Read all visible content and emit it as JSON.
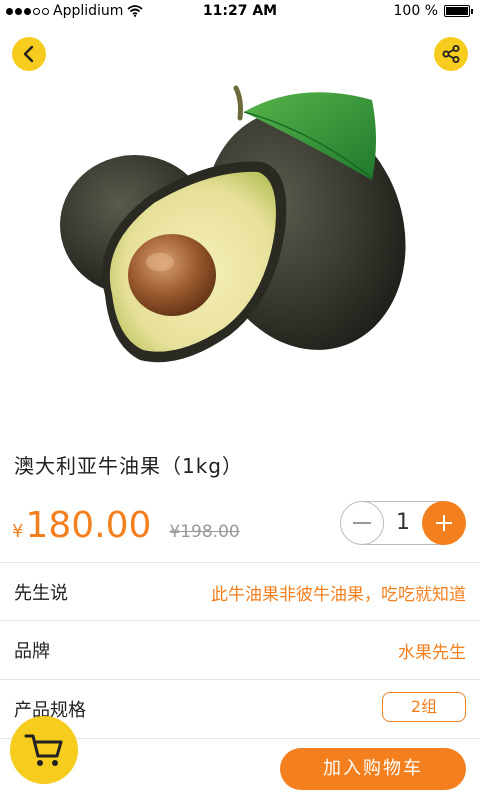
{
  "status_bar": {
    "carrier": "Applidium",
    "time": "11:27 AM",
    "battery": "100 %"
  },
  "product": {
    "title": "澳大利亚牛油果（1kg）",
    "currency": "¥",
    "price": "180.00",
    "old_price": "¥198.00"
  },
  "quantity": {
    "value": "1"
  },
  "info": {
    "slogan_label": "先生说",
    "slogan_value": "此牛油果非彼牛油果，吃吃就知道",
    "brand_label": "品牌",
    "brand_value": "水果先生",
    "spec_label": "产品规格",
    "spec_value": "2组"
  },
  "actions": {
    "add_to_cart": "加入购物车"
  },
  "colors": {
    "accent_orange": "#f47f1f",
    "accent_yellow": "#f6cc1e"
  },
  "icons": {
    "back": "chevron-left-icon",
    "share": "share-icon",
    "cart": "cart-icon",
    "minus": "minus-icon",
    "plus": "plus-icon"
  }
}
